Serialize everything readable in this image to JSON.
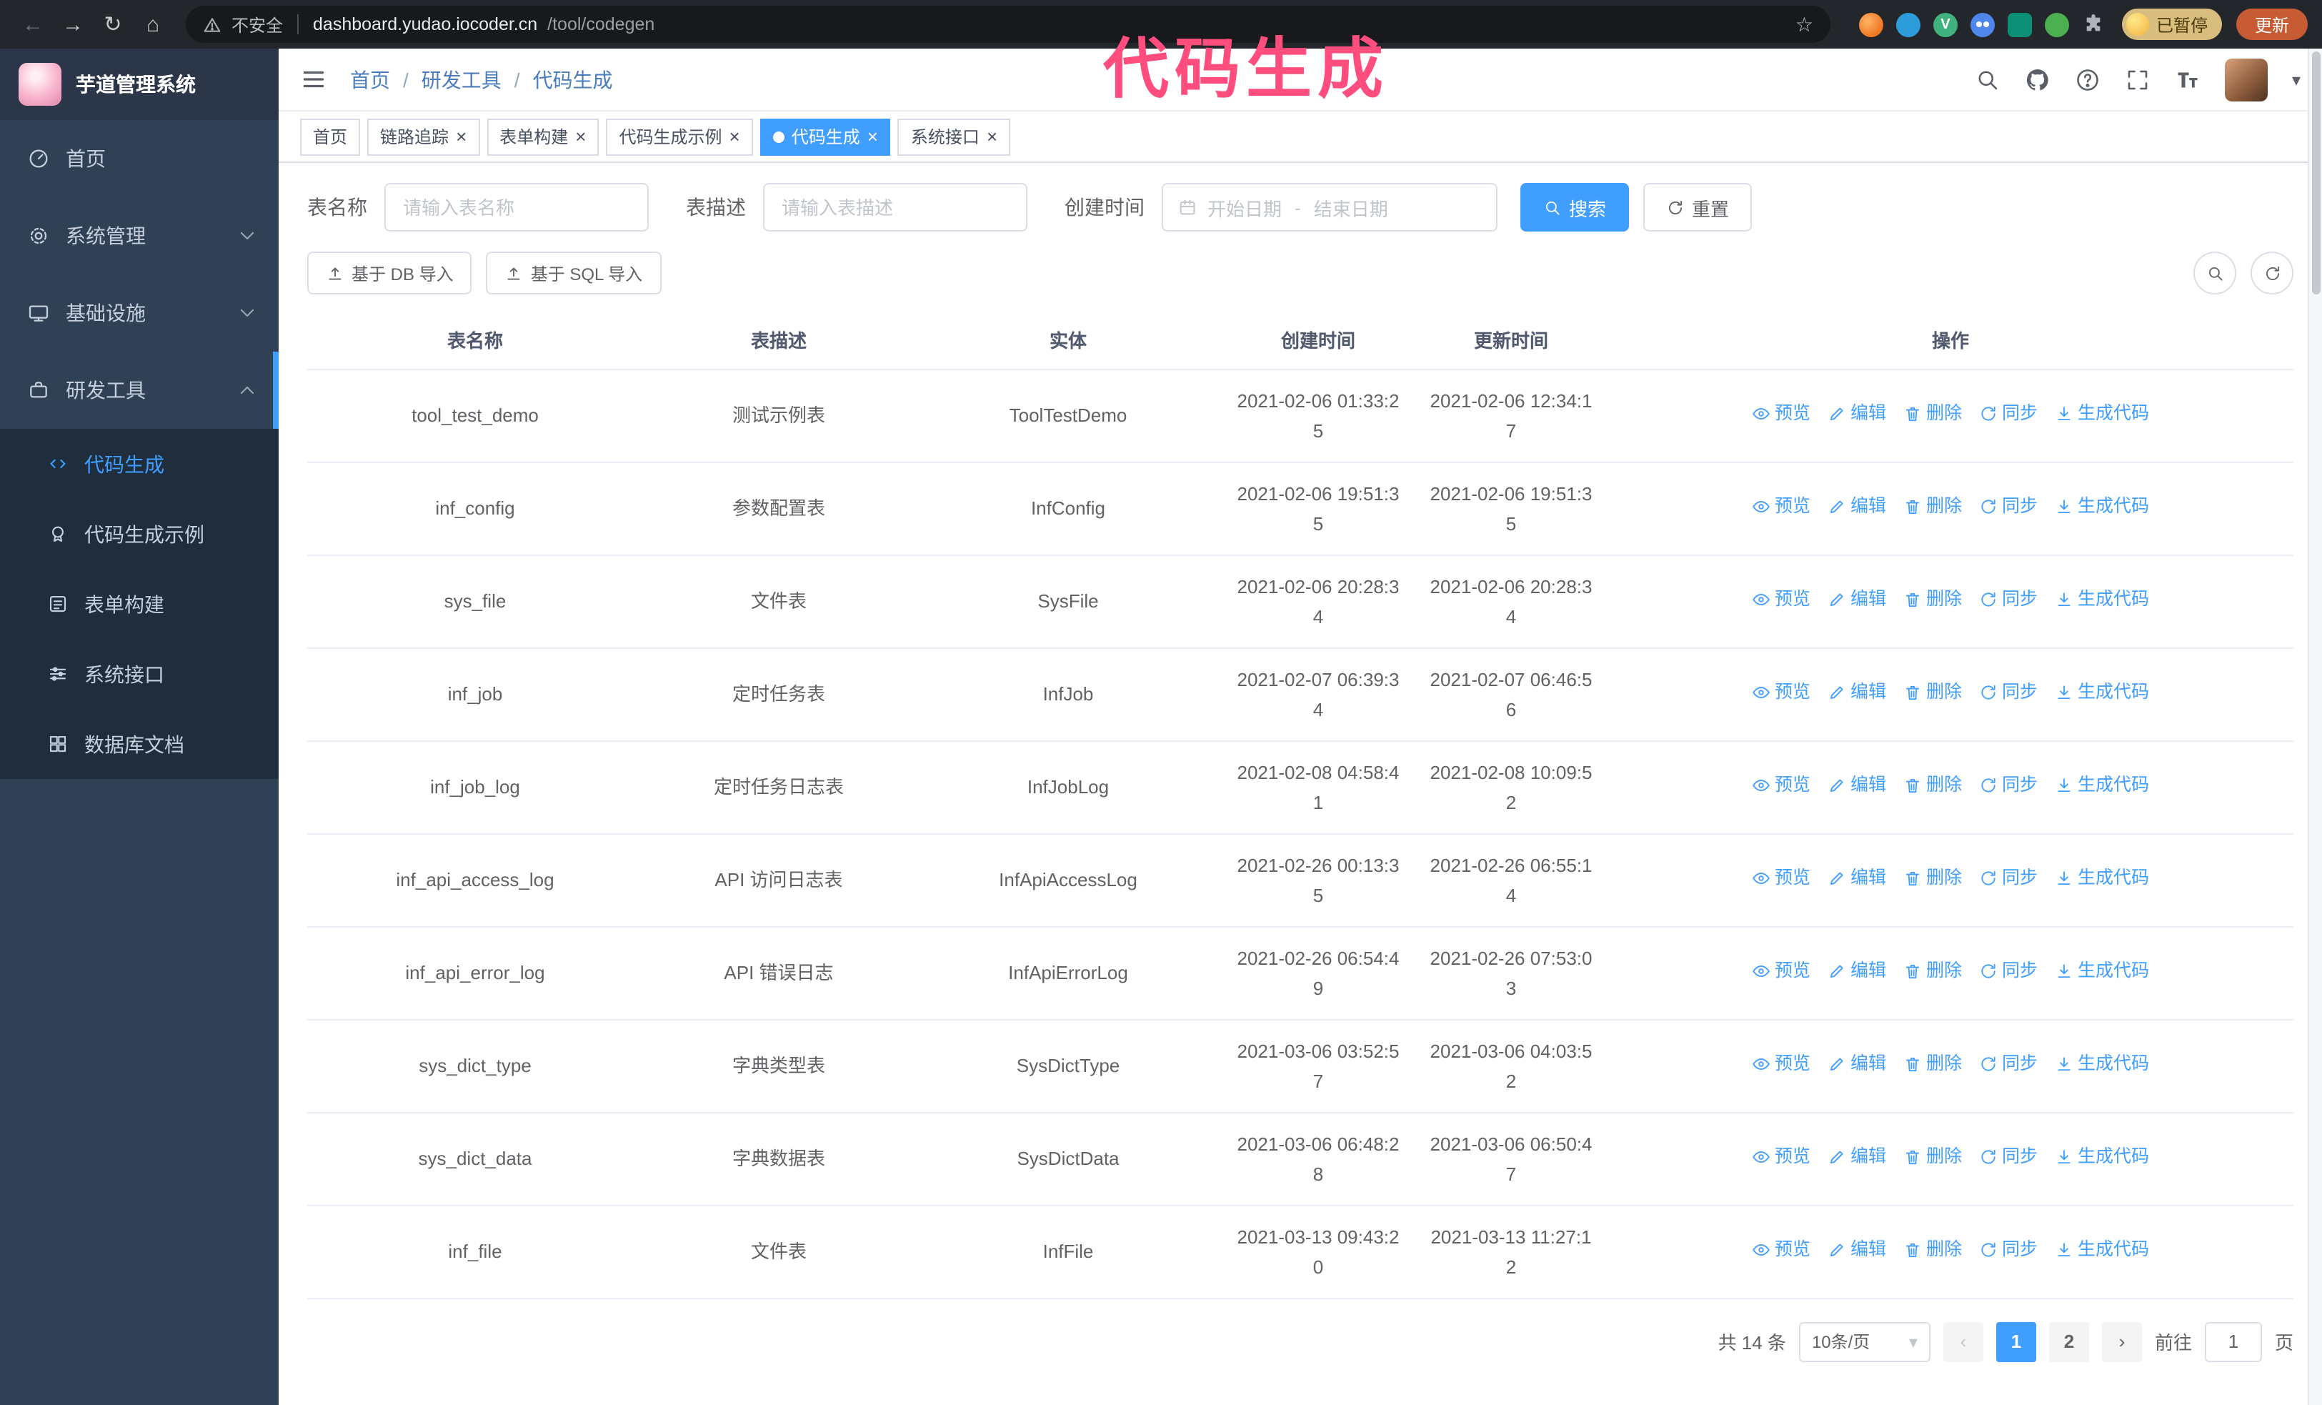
{
  "colors": {
    "accent": "#409eff",
    "sidebar_bg": "#304156",
    "submenu_bg": "#1f2d3d",
    "annotation_pink": "#ff4d7d",
    "update_button_bg": "#c75b33"
  },
  "icons": {
    "back": "←",
    "forward": "→",
    "reload": "↻",
    "home": "⌂",
    "star": "☆",
    "close": "×",
    "caret_down": "▾",
    "prev": "‹",
    "next": "›"
  },
  "browser": {
    "security_label": "不安全",
    "url_host": "dashboard.yudao.iocoder.cn",
    "url_path": "/tool/codegen",
    "paused_badge": "已暂停",
    "update_button": "更新"
  },
  "annotation": {
    "title": "代码生成"
  },
  "sidebar": {
    "logo_title": "芋道管理系统",
    "items": [
      {
        "label": "首页"
      },
      {
        "label": "系统管理"
      },
      {
        "label": "基础设施"
      },
      {
        "label": "研发工具"
      }
    ],
    "sub_items": [
      {
        "label": "代码生成"
      },
      {
        "label": "代码生成示例"
      },
      {
        "label": "表单构建"
      },
      {
        "label": "系统接口"
      },
      {
        "label": "数据库文档"
      }
    ]
  },
  "header": {
    "breadcrumb": [
      "首页",
      "研发工具",
      "代码生成"
    ],
    "separator": "/"
  },
  "tabs": [
    {
      "label": "首页",
      "closable": false,
      "active": false
    },
    {
      "label": "链路追踪",
      "closable": true,
      "active": false
    },
    {
      "label": "表单构建",
      "closable": true,
      "active": false
    },
    {
      "label": "代码生成示例",
      "closable": true,
      "active": false
    },
    {
      "label": "代码生成",
      "closable": true,
      "active": true
    },
    {
      "label": "系统接口",
      "closable": true,
      "active": false
    }
  ],
  "filters": {
    "table_name_label": "表名称",
    "table_name_placeholder": "请输入表名称",
    "table_desc_label": "表描述",
    "table_desc_placeholder": "请输入表描述",
    "create_time_label": "创建时间",
    "date_start_placeholder": "开始日期",
    "date_range_separator": "-",
    "date_end_placeholder": "结束日期",
    "search_button": "搜索",
    "reset_button": "重置"
  },
  "toolbar": {
    "import_db": "基于 DB 导入",
    "import_sql": "基于 SQL 导入"
  },
  "table": {
    "columns": [
      "表名称",
      "表描述",
      "实体",
      "创建时间",
      "更新时间",
      "操作"
    ],
    "actions": [
      {
        "label": "预览",
        "icon": "eye-icon",
        "name": "preview-action"
      },
      {
        "label": "编辑",
        "icon": "edit-icon",
        "name": "edit-action"
      },
      {
        "label": "删除",
        "icon": "delete-icon",
        "name": "delete-action"
      },
      {
        "label": "同步",
        "icon": "sync-icon",
        "name": "sync-action"
      },
      {
        "label": "生成代码",
        "icon": "download-icon",
        "name": "generate-code-action"
      }
    ],
    "rows": [
      {
        "name": "tool_test_demo",
        "desc": "测试示例表",
        "entity": "ToolTestDemo",
        "created": "2021-02-06 01:33:25",
        "updated": "2021-02-06 12:34:17"
      },
      {
        "name": "inf_config",
        "desc": "参数配置表",
        "entity": "InfConfig",
        "created": "2021-02-06 19:51:35",
        "updated": "2021-02-06 19:51:35"
      },
      {
        "name": "sys_file",
        "desc": "文件表",
        "entity": "SysFile",
        "created": "2021-02-06 20:28:34",
        "updated": "2021-02-06 20:28:34"
      },
      {
        "name": "inf_job",
        "desc": "定时任务表",
        "entity": "InfJob",
        "created": "2021-02-07 06:39:34",
        "updated": "2021-02-07 06:46:56"
      },
      {
        "name": "inf_job_log",
        "desc": "定时任务日志表",
        "entity": "InfJobLog",
        "created": "2021-02-08 04:58:41",
        "updated": "2021-02-08 10:09:52"
      },
      {
        "name": "inf_api_access_log",
        "desc": "API 访问日志表",
        "entity": "InfApiAccessLog",
        "created": "2021-02-26 00:13:35",
        "updated": "2021-02-26 06:55:14"
      },
      {
        "name": "inf_api_error_log",
        "desc": "API 错误日志",
        "entity": "InfApiErrorLog",
        "created": "2021-02-26 06:54:49",
        "updated": "2021-02-26 07:53:03"
      },
      {
        "name": "sys_dict_type",
        "desc": "字典类型表",
        "entity": "SysDictType",
        "created": "2021-03-06 03:52:57",
        "updated": "2021-03-06 04:03:52"
      },
      {
        "name": "sys_dict_data",
        "desc": "字典数据表",
        "entity": "SysDictData",
        "created": "2021-03-06 06:48:28",
        "updated": "2021-03-06 06:50:47"
      },
      {
        "name": "inf_file",
        "desc": "文件表",
        "entity": "InfFile",
        "created": "2021-03-13 09:43:20",
        "updated": "2021-03-13 11:27:12"
      }
    ]
  },
  "pagination": {
    "total": "共 14 条",
    "page_size": "10条/页",
    "pages": [
      "1",
      "2"
    ],
    "active_page": "1",
    "goto_label": "前往",
    "goto_value": "1",
    "goto_unit": "页"
  }
}
